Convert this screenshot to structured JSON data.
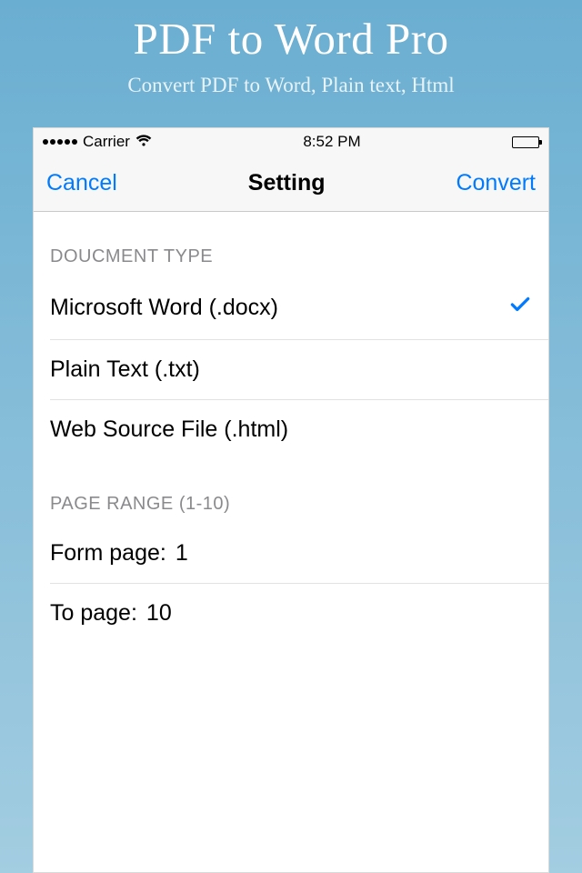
{
  "hero": {
    "title": "PDF to Word Pro",
    "subtitle": "Convert PDF to Word, Plain text, Html"
  },
  "statusbar": {
    "carrier": "Carrier",
    "time": "8:52 PM"
  },
  "navbar": {
    "left": "Cancel",
    "title": "Setting",
    "right": "Convert"
  },
  "sections": {
    "doc_type": {
      "header": "DOUCMENT TYPE",
      "options": [
        {
          "label": "Microsoft Word (.docx)",
          "selected": true
        },
        {
          "label": "Plain Text (.txt)",
          "selected": false
        },
        {
          "label": "Web Source File (.html)",
          "selected": false
        }
      ]
    },
    "page_range": {
      "header": "PAGE RANGE (1-10)",
      "from_label": "Form page:",
      "from_value": "1",
      "to_label": "To page:",
      "to_value": "10"
    }
  }
}
